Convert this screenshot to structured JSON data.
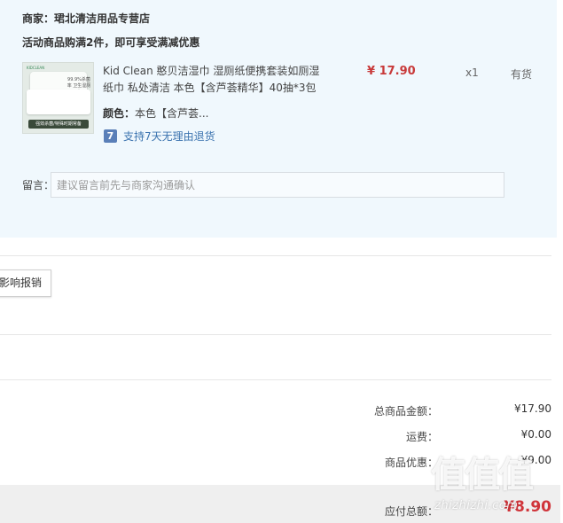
{
  "shop": {
    "label": "商家：",
    "name": "珺北清洁用品专营店"
  },
  "promotion": {
    "text": "活动商品购满2件，即可享受满减优惠"
  },
  "item": {
    "image_text": "99.9%杀菌率 卫生湿厕巾",
    "image_brand": "KIDCLEAN",
    "image_banner": "强效杀菌/特殊时期常备",
    "title": "Kid Clean 憨贝洁湿巾 湿厕纸便携套装如厕湿纸巾 私处清洁 本色【含芦荟精华】40抽*3包",
    "price": "¥ 17.90",
    "quantity": "x1",
    "stock": "有货",
    "attr_label": "颜色：",
    "attr_value": "本色【含芦荟...",
    "return_badge": "7",
    "return_text": "支持7天无理由退货"
  },
  "note": {
    "label": "留言：",
    "placeholder": "建议留言前先与商家沟通确认",
    "value": ""
  },
  "invoice": {
    "reimburse_label": "影响报销"
  },
  "summary": {
    "goods_total_label": "总商品金额：",
    "goods_total_value": "¥17.90",
    "shipping_label": "运费：",
    "shipping_value": "¥0.00",
    "discount_label": "商品优惠：",
    "discount_value": "-¥9.00",
    "payable_label": "应付总额：",
    "payable_value": "¥8.90"
  },
  "watermark": {
    "logo": "值值值",
    "site": "zhizhizhi.com"
  },
  "colors": {
    "panel_bg": "#f0f8fd",
    "price_red": "#c83a3a",
    "total_red": "#d0343a",
    "link_blue": "#3b73af"
  }
}
